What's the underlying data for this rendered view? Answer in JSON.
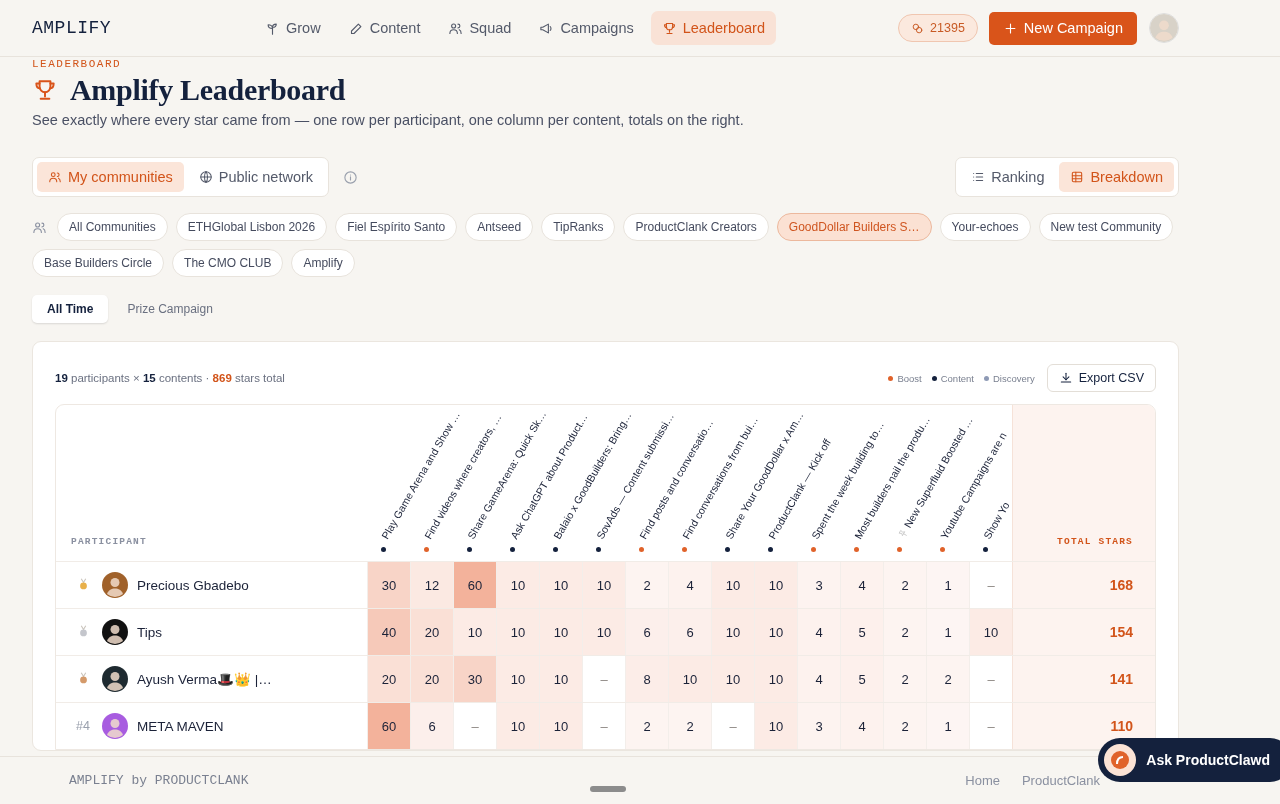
{
  "header": {
    "logo": "AMPLIFY",
    "nav": [
      {
        "label": "Grow",
        "kind": "sprout",
        "selected": false
      },
      {
        "label": "Content",
        "kind": "pencil",
        "selected": false
      },
      {
        "label": "Squad",
        "kind": "people",
        "selected": false
      },
      {
        "label": "Campaigns",
        "kind": "megaphone",
        "selected": false
      },
      {
        "label": "Leaderboard",
        "kind": "trophy",
        "selected": true
      }
    ],
    "points": "21395",
    "new_button": "New Campaign"
  },
  "page": {
    "eyebrow": "LEADERBOARD",
    "title": "Amplify Leaderboard",
    "subtitle": "See exactly where every star came from — one row per participant, one column per content, totals on the right."
  },
  "scope": [
    {
      "label": "My communities",
      "kind": "people",
      "selected": true
    },
    {
      "label": "Public network",
      "kind": "globe",
      "selected": false
    }
  ],
  "views": [
    {
      "label": "Ranking",
      "kind": "list",
      "selected": false
    },
    {
      "label": "Breakdown",
      "kind": "grid",
      "selected": true
    }
  ],
  "communities": [
    {
      "label": "All Communities",
      "selected": false
    },
    {
      "label": "ETHGlobal Lisbon 2026",
      "selected": false
    },
    {
      "label": "Fiel Espírito Santo",
      "selected": false
    },
    {
      "label": "Antseed",
      "selected": false
    },
    {
      "label": "TipRanks",
      "selected": false
    },
    {
      "label": "ProductClank Creators",
      "selected": false
    },
    {
      "label": "GoodDollar Builders S…",
      "selected": true
    },
    {
      "label": "Your-echoes",
      "selected": false
    },
    {
      "label": "New test Community",
      "selected": false
    },
    {
      "label": "Base Builders Circle",
      "selected": false
    },
    {
      "label": "The CMO CLUB",
      "selected": false
    },
    {
      "label": "Amplify",
      "selected": false
    }
  ],
  "periods": [
    {
      "label": "All Time",
      "selected": true
    },
    {
      "label": "Prize Campaign",
      "selected": false
    }
  ],
  "summary": "**19** participants × **15** contents · **869** stars total",
  "legend": [
    {
      "label": "Boost",
      "color": "#e0622a"
    },
    {
      "label": "Content",
      "color": "#14213d"
    },
    {
      "label": "Discovery",
      "color": "#8e9ab5"
    }
  ],
  "export_button": "Export CSV",
  "table": {
    "participant_heading": "PARTICIPANT",
    "total_heading": "TOTAL STARS",
    "columns": [
      {
        "title": "Play Game Arena and Show …",
        "kind": "content"
      },
      {
        "title": "Find videos where creators, …",
        "kind": "boost"
      },
      {
        "title": "Share GameArena: Quick Sk…",
        "kind": "content"
      },
      {
        "title": "Ask ChatGPT about Product…",
        "kind": "content"
      },
      {
        "title": "Balaio x GoodBuilders: Bring…",
        "kind": "content"
      },
      {
        "title": "SovAds — Content submissi…",
        "kind": "content"
      },
      {
        "title": "Find posts and conversatio…",
        "kind": "boost"
      },
      {
        "title": "Find conversations from bui…",
        "kind": "boost"
      },
      {
        "title": "Share Your GoodDollar x Am…",
        "kind": "content"
      },
      {
        "title": "ProductClank — Kick off",
        "kind": "content"
      },
      {
        "title": "Spent the week building to…",
        "kind": "boost"
      },
      {
        "title": "Most builders nail the produ…",
        "kind": "boost"
      },
      {
        "title": "New Superfluid Boosted …",
        "kind": "boost",
        "pinned": true
      },
      {
        "title": "Youtube Campaigns are n",
        "kind": "boost"
      },
      {
        "title": "Show Yo",
        "kind": "content"
      }
    ],
    "rows": [
      {
        "kind": "medal",
        "medal": {
          "color": "#e8b04a"
        },
        "name": "Precious Gbadebo",
        "color": "#a0612a",
        "cells": [
          "30",
          "12",
          "60",
          "10",
          "10",
          "10",
          "2",
          "4",
          "10",
          "10",
          "3",
          "4",
          "2",
          "1",
          "–"
        ],
        "total": "168"
      },
      {
        "kind": "medal",
        "medal": {
          "color": "#c4c6cc"
        },
        "name": "Tips",
        "color": "#111111",
        "cells": [
          "40",
          "20",
          "10",
          "10",
          "10",
          "10",
          "6",
          "6",
          "10",
          "10",
          "4",
          "5",
          "2",
          "1",
          "10"
        ],
        "total": "154"
      },
      {
        "kind": "medal",
        "medal": {
          "color": "#d49a6a"
        },
        "name": "Ayush Verma🎩👑 |…",
        "color": "#1e2a30",
        "cells": [
          "20",
          "20",
          "30",
          "10",
          "10",
          "–",
          "8",
          "10",
          "10",
          "10",
          "4",
          "5",
          "2",
          "2",
          "–"
        ],
        "total": "141"
      },
      {
        "kind": "rank",
        "rank": "#4",
        "name": "META MAVEN",
        "color": "#a85ce0",
        "cells": [
          "60",
          "6",
          "–",
          "10",
          "10",
          "–",
          "2",
          "2",
          "–",
          "10",
          "3",
          "4",
          "2",
          "1",
          "–"
        ],
        "total": "110"
      }
    ]
  },
  "footer": {
    "brand": "AMPLIFY by PRODUCTCLANK",
    "links": [
      "Home",
      "ProductClank"
    ]
  },
  "assistant_button": "Ask ProductClawd"
}
